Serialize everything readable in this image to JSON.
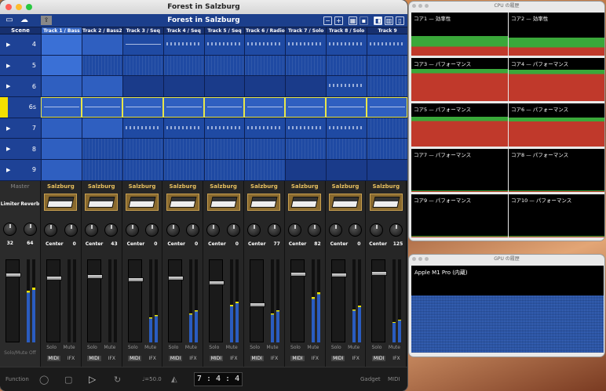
{
  "app": {
    "window_title": "Forest in Salzburg",
    "song_title": "Forest in Salzburg"
  },
  "grid": {
    "scene_header": "Scene",
    "scenes": [
      "4",
      "5",
      "6",
      "6s",
      "7",
      "8",
      "9"
    ],
    "tracks": [
      "Track 1 / Bass",
      "Track 2 / Bass2",
      "Track 3 / Seq",
      "Track 4 / Seq",
      "Track 5 / Seq",
      "Track 6 / Radio",
      "Track 7 / Solo",
      "Track 8 / Solo",
      "Track 9"
    ]
  },
  "mixer": {
    "master": {
      "label": "Master",
      "limiter": "Limiter",
      "reverb": "Reverb",
      "values": [
        "32",
        "64"
      ],
      "solo_mute_off": "Solo/Mute Off"
    },
    "strips": [
      {
        "name": "Salzburg",
        "pan": "Center",
        "val": "0",
        "fader": 0.8,
        "meter": 0.0
      },
      {
        "name": "Salzburg",
        "pan": "Center",
        "val": "43",
        "fader": 0.82,
        "meter": 0.0
      },
      {
        "name": "Salzburg",
        "pan": "Center",
        "val": "0",
        "fader": 0.78,
        "meter": 0.3
      },
      {
        "name": "Salzburg",
        "pan": "Center",
        "val": "0",
        "fader": 0.8,
        "meter": 0.35
      },
      {
        "name": "Salzburg",
        "pan": "Center",
        "val": "0",
        "fader": 0.74,
        "meter": 0.45
      },
      {
        "name": "Salzburg",
        "pan": "Center",
        "val": "77",
        "fader": 0.46,
        "meter": 0.35
      },
      {
        "name": "Salzburg",
        "pan": "Center",
        "val": "82",
        "fader": 0.85,
        "meter": 0.55
      },
      {
        "name": "Salzburg",
        "pan": "Center",
        "val": "0",
        "fader": 0.84,
        "meter": 0.4
      },
      {
        "name": "Salzburg",
        "pan": "Center",
        "val": "125",
        "fader": 0.86,
        "meter": 0.25
      }
    ],
    "solo": "Solo",
    "mute": "Mute",
    "midi": "MIDI",
    "ifx": "IFX"
  },
  "bottom": {
    "function": "Function",
    "tempo": "♩=50.0",
    "position": "7 : 4 : 4",
    "gadget": "Gadget",
    "midi": "MIDI"
  },
  "cpu_window": {
    "title": "CPU の履歴",
    "cores": [
      "コア1 — 効率性",
      "コア2 — 効率性",
      "コア3 — パフォーマンス",
      "コア4 — パフォーマンス",
      "コア5 — パフォーマンス",
      "コア6 — パフォーマンス",
      "コア7 — パフォーマンス",
      "コア8 — パフォーマンス",
      "コア9 — パフォーマンス",
      "コア10 — パフォーマンス"
    ],
    "core_loads": [
      0.45,
      0.42,
      0.75,
      0.72,
      0.7,
      0.68,
      0.03,
      0.04,
      0.03,
      0.03
    ]
  },
  "gpu_window": {
    "title": "GPU の履歴",
    "label": "Apple M1 Pro (内蔵)",
    "load": 0.65
  },
  "colors": {
    "grid_blue": "#1f4aa3",
    "play_yellow": "#f4e000",
    "cpu_user": "#3aa83a",
    "cpu_system": "#c0392b",
    "gpu": "#3466c0"
  }
}
